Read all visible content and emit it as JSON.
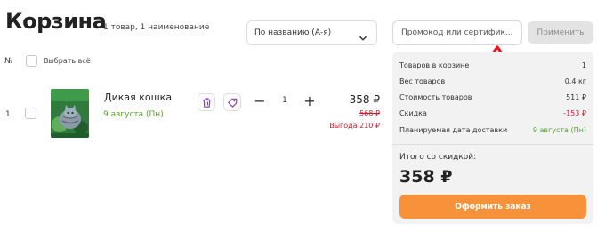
{
  "header": {
    "title": "Корзина",
    "subtitle": "1 товар, 1 наименование"
  },
  "sort": {
    "selected": "По названию (А-я)",
    "icon": "chevron-down-icon"
  },
  "promo": {
    "placeholder": "Промокод или сертифик...",
    "apply_label": "Применить"
  },
  "list_header": {
    "number_label": "№",
    "select_all_label": "Выбрать всё"
  },
  "items": [
    {
      "number": "1",
      "name": "Дикая кошка",
      "delivery_date": "9 августа (Пн)",
      "quantity": "1",
      "minus": "−",
      "plus": "+",
      "price": "358 ₽",
      "old_price": "568 ₽",
      "benefit": "Выгода 210 ₽",
      "cover_title": "ДИКАЯ КОШКА"
    }
  ],
  "summary": {
    "rows": [
      {
        "label": "Товаров в корзине",
        "value": "1"
      },
      {
        "label": "Вес товаров",
        "value": "0.4 кг"
      },
      {
        "label": "Стоимость товаров",
        "value": "511 ₽"
      },
      {
        "label": "Скидка",
        "value": "-153 ₽"
      },
      {
        "label": "Планируемая дата доставки",
        "value": "9 августа (Пн)"
      }
    ],
    "total_label": "Итого со скидкой:",
    "total_value": "358 ₽",
    "checkout_label": "Оформить заказ"
  },
  "colors": {
    "accent_orange": "#f7923a",
    "discount_red": "#d11a2a",
    "date_green": "#5a9e31",
    "annotation_arrow": "#e8141e",
    "icon_purple": "#8a3fb8"
  }
}
